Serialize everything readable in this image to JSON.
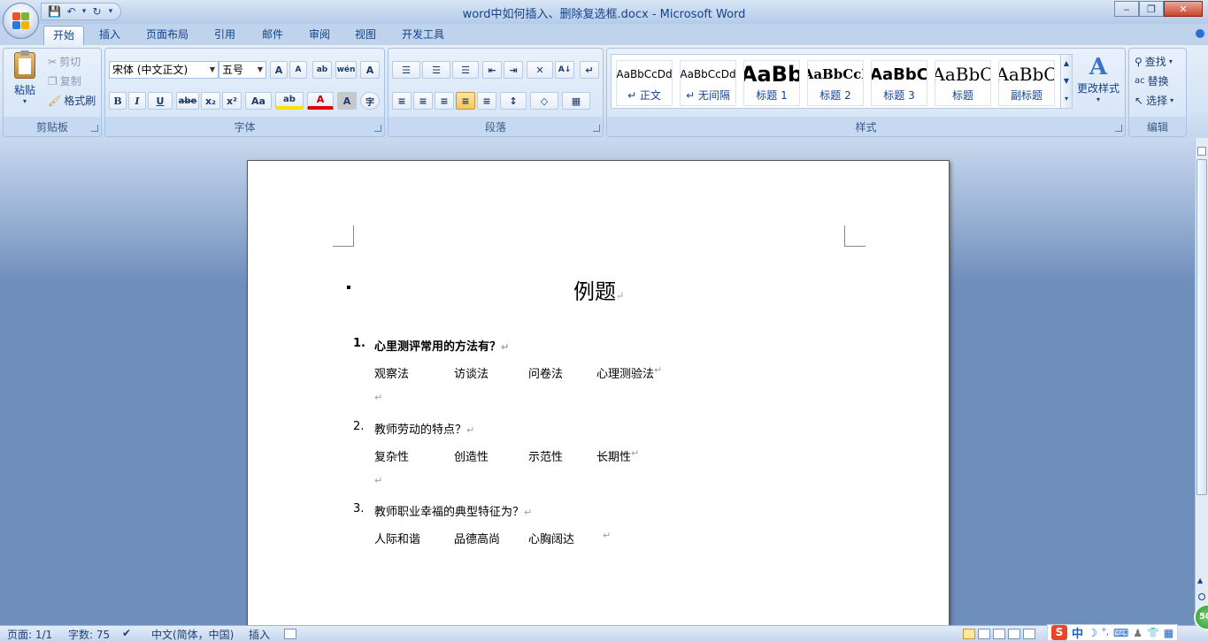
{
  "window": {
    "title": "word中如何插入、删除复选框.docx - Microsoft Word",
    "min": "‒",
    "max": "❐",
    "close": "✕"
  },
  "qat": {
    "save": "💾",
    "undo": "↶",
    "dropdown1": "▾",
    "redo": "↻",
    "customize": "▾"
  },
  "tabs": [
    "开始",
    "插入",
    "页面布局",
    "引用",
    "邮件",
    "审阅",
    "视图",
    "开发工具"
  ],
  "clipboard": {
    "paste": "粘贴",
    "cut": "剪切",
    "copy": "复制",
    "format_painter": "格式刷",
    "label": "剪贴板"
  },
  "font": {
    "name": "宋体 (中文正文)",
    "size": "五号",
    "grow": "A",
    "shrink": "A",
    "clear": "ab",
    "phonetic": "wén",
    "border": "A",
    "bold": "B",
    "italic": "I",
    "underline": "U",
    "strike": "abe",
    "subscript": "x₂",
    "superscript": "x²",
    "case": "Aa",
    "highlight": "ab",
    "color": "A",
    "shade": "A",
    "enclose": "字",
    "label": "字体"
  },
  "paragraph": {
    "label": "段落",
    "bullets": "☰",
    "numbering": "☰",
    "multilevel": "☰",
    "dec_indent": "⇤",
    "inc_indent": "⇥",
    "chinese_layout": "✕",
    "sort": "A↓",
    "show_marks": "↵",
    "align_left": "≡",
    "center": "≡",
    "align_right": "≡",
    "justify": "≡",
    "distributed": "≡",
    "line_spacing": "↕",
    "shading": "◇",
    "borders": "▦"
  },
  "styles": {
    "label": "样式",
    "change": "更改样式",
    "items": [
      {
        "preview": "AaBbCcDd",
        "name": "↵ 正文"
      },
      {
        "preview": "AaBbCcDd",
        "name": "↵ 无间隔"
      },
      {
        "preview": "AaBb",
        "name": "标题 1"
      },
      {
        "preview": "AaBbCcI",
        "name": "标题 2"
      },
      {
        "preview": "AaBbC",
        "name": "标题 3"
      },
      {
        "preview": "AaBbC",
        "name": "标题"
      },
      {
        "preview": "AaBbC",
        "name": "副标题"
      }
    ]
  },
  "editing": {
    "find": "查找",
    "replace": "替换",
    "select": "选择",
    "label": "编辑"
  },
  "document": {
    "title": "例题",
    "para_mark": "↵",
    "questions": [
      {
        "num": "1.",
        "text": "心里测评常用的方法有？",
        "options": [
          "观察法",
          "访谈法",
          "问卷法",
          "心理测验法"
        ]
      },
      {
        "num": "2.",
        "text": "教师劳动的特点？",
        "options": [
          "复杂性",
          "创造性",
          "示范性",
          "长期性"
        ]
      },
      {
        "num": "3.",
        "text": "教师职业幸福的典型特征为？",
        "options": [
          "人际和谐",
          "品德高尚",
          "心胸阔达"
        ]
      }
    ]
  },
  "status": {
    "page": "页面: 1/1",
    "words": "字数: 75",
    "lang": "中文(简体，中国)",
    "mode": "插入"
  },
  "ime": {
    "logo": "S",
    "mode": "中",
    "moon": "☽",
    "punct": "°,",
    "kbd": "⌨",
    "user": "♟",
    "shirt": "👕",
    "grid": "▦"
  },
  "zoom_badge": "50"
}
